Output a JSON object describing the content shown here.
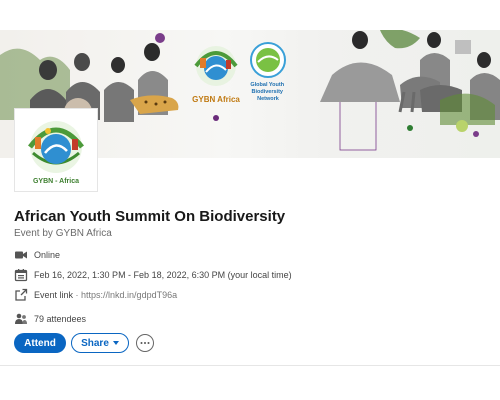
{
  "banner": {
    "logo_text_left": "GYBN Africa",
    "logo_text_right": "Global Youth Biodiversity Network"
  },
  "event_logo": {
    "caption": "GYBN - Africa"
  },
  "event": {
    "title": "African Youth Summit On Biodiversity",
    "organizer": "Event by GYBN Africa",
    "location": "Online",
    "datetime": "Feb 16, 2022, 1:30 PM - Feb 18, 2022, 6:30 PM (your local time)",
    "link_label": "Event link",
    "link_separator": " · ",
    "link_url": "https://lnkd.in/gdpdT96a",
    "attendees": "79 attendees"
  },
  "actions": {
    "attend_label": "Attend",
    "share_label": "Share"
  },
  "icons": {
    "location": "video-camera-icon",
    "date": "calendar-icon",
    "link": "external-link-icon",
    "attendees": "people-icon",
    "more": "ellipsis-icon",
    "share_dropdown": "caret-down-icon"
  },
  "colors": {
    "primary": "#0a66c2",
    "text": "#191919",
    "secondary_text": "#666666"
  }
}
